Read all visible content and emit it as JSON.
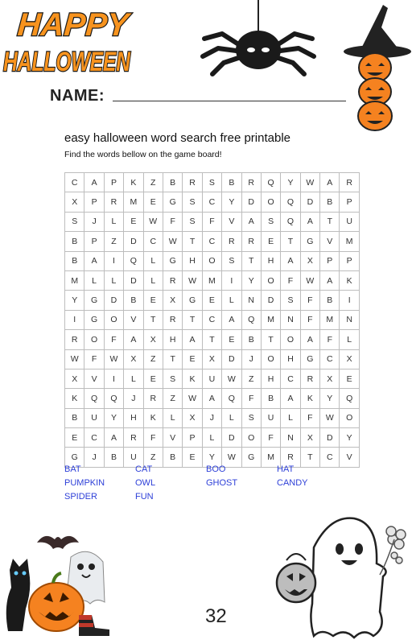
{
  "header": {
    "logo_line1": "HAPPY",
    "logo_line2": "HALLOWEEN",
    "name_label": "NAME:"
  },
  "main": {
    "title": "easy halloween word search free printable",
    "instructions": "Find the words bellow on the game board!"
  },
  "grid": [
    [
      "C",
      "A",
      "P",
      "K",
      "Z",
      "B",
      "R",
      "S",
      "B",
      "R",
      "Q",
      "Y",
      "W",
      "A",
      "R"
    ],
    [
      "X",
      "P",
      "R",
      "M",
      "E",
      "G",
      "S",
      "C",
      "Y",
      "D",
      "O",
      "Q",
      "D",
      "B",
      "P"
    ],
    [
      "S",
      "J",
      "L",
      "E",
      "W",
      "F",
      "S",
      "F",
      "V",
      "A",
      "S",
      "Q",
      "A",
      "T",
      "U"
    ],
    [
      "B",
      "P",
      "Z",
      "D",
      "C",
      "W",
      "T",
      "C",
      "R",
      "R",
      "E",
      "T",
      "G",
      "V",
      "M"
    ],
    [
      "B",
      "A",
      "I",
      "Q",
      "L",
      "G",
      "H",
      "O",
      "S",
      "T",
      "H",
      "A",
      "X",
      "P",
      "P"
    ],
    [
      "M",
      "L",
      "L",
      "D",
      "L",
      "R",
      "W",
      "M",
      "I",
      "Y",
      "O",
      "F",
      "W",
      "A",
      "K"
    ],
    [
      "Y",
      "G",
      "D",
      "B",
      "E",
      "X",
      "G",
      "E",
      "L",
      "N",
      "D",
      "S",
      "F",
      "B",
      "I"
    ],
    [
      "I",
      "G",
      "O",
      "V",
      "T",
      "R",
      "T",
      "C",
      "A",
      "Q",
      "M",
      "N",
      "F",
      "M",
      "N"
    ],
    [
      "R",
      "O",
      "F",
      "A",
      "X",
      "H",
      "A",
      "T",
      "E",
      "B",
      "T",
      "O",
      "A",
      "F",
      "L"
    ],
    [
      "W",
      "F",
      "W",
      "X",
      "Z",
      "T",
      "E",
      "X",
      "D",
      "J",
      "O",
      "H",
      "G",
      "C",
      "X"
    ],
    [
      "X",
      "V",
      "I",
      "L",
      "E",
      "S",
      "K",
      "U",
      "W",
      "Z",
      "H",
      "C",
      "R",
      "X",
      "E"
    ],
    [
      "K",
      "Q",
      "Q",
      "J",
      "R",
      "Z",
      "W",
      "A",
      "Q",
      "F",
      "B",
      "A",
      "K",
      "Y",
      "Q"
    ],
    [
      "B",
      "U",
      "Y",
      "H",
      "K",
      "L",
      "X",
      "J",
      "L",
      "S",
      "U",
      "L",
      "F",
      "W",
      "O"
    ],
    [
      "E",
      "C",
      "A",
      "R",
      "F",
      "V",
      "P",
      "L",
      "D",
      "O",
      "F",
      "N",
      "X",
      "D",
      "Y"
    ],
    [
      "G",
      "J",
      "B",
      "U",
      "Z",
      "B",
      "E",
      "Y",
      "W",
      "G",
      "M",
      "R",
      "T",
      "C",
      "V"
    ]
  ],
  "words": [
    "BAT",
    "CAT",
    "BOO",
    "HAT",
    "PUMPKIN",
    "OWL",
    "GHOST",
    "CANDY",
    "SPIDER",
    "FUN"
  ],
  "footer": {
    "page_number": "32"
  },
  "colors": {
    "word_list": "#2d3fd8",
    "logo_orange": "#f7931e",
    "pumpkin": "#f58220"
  }
}
